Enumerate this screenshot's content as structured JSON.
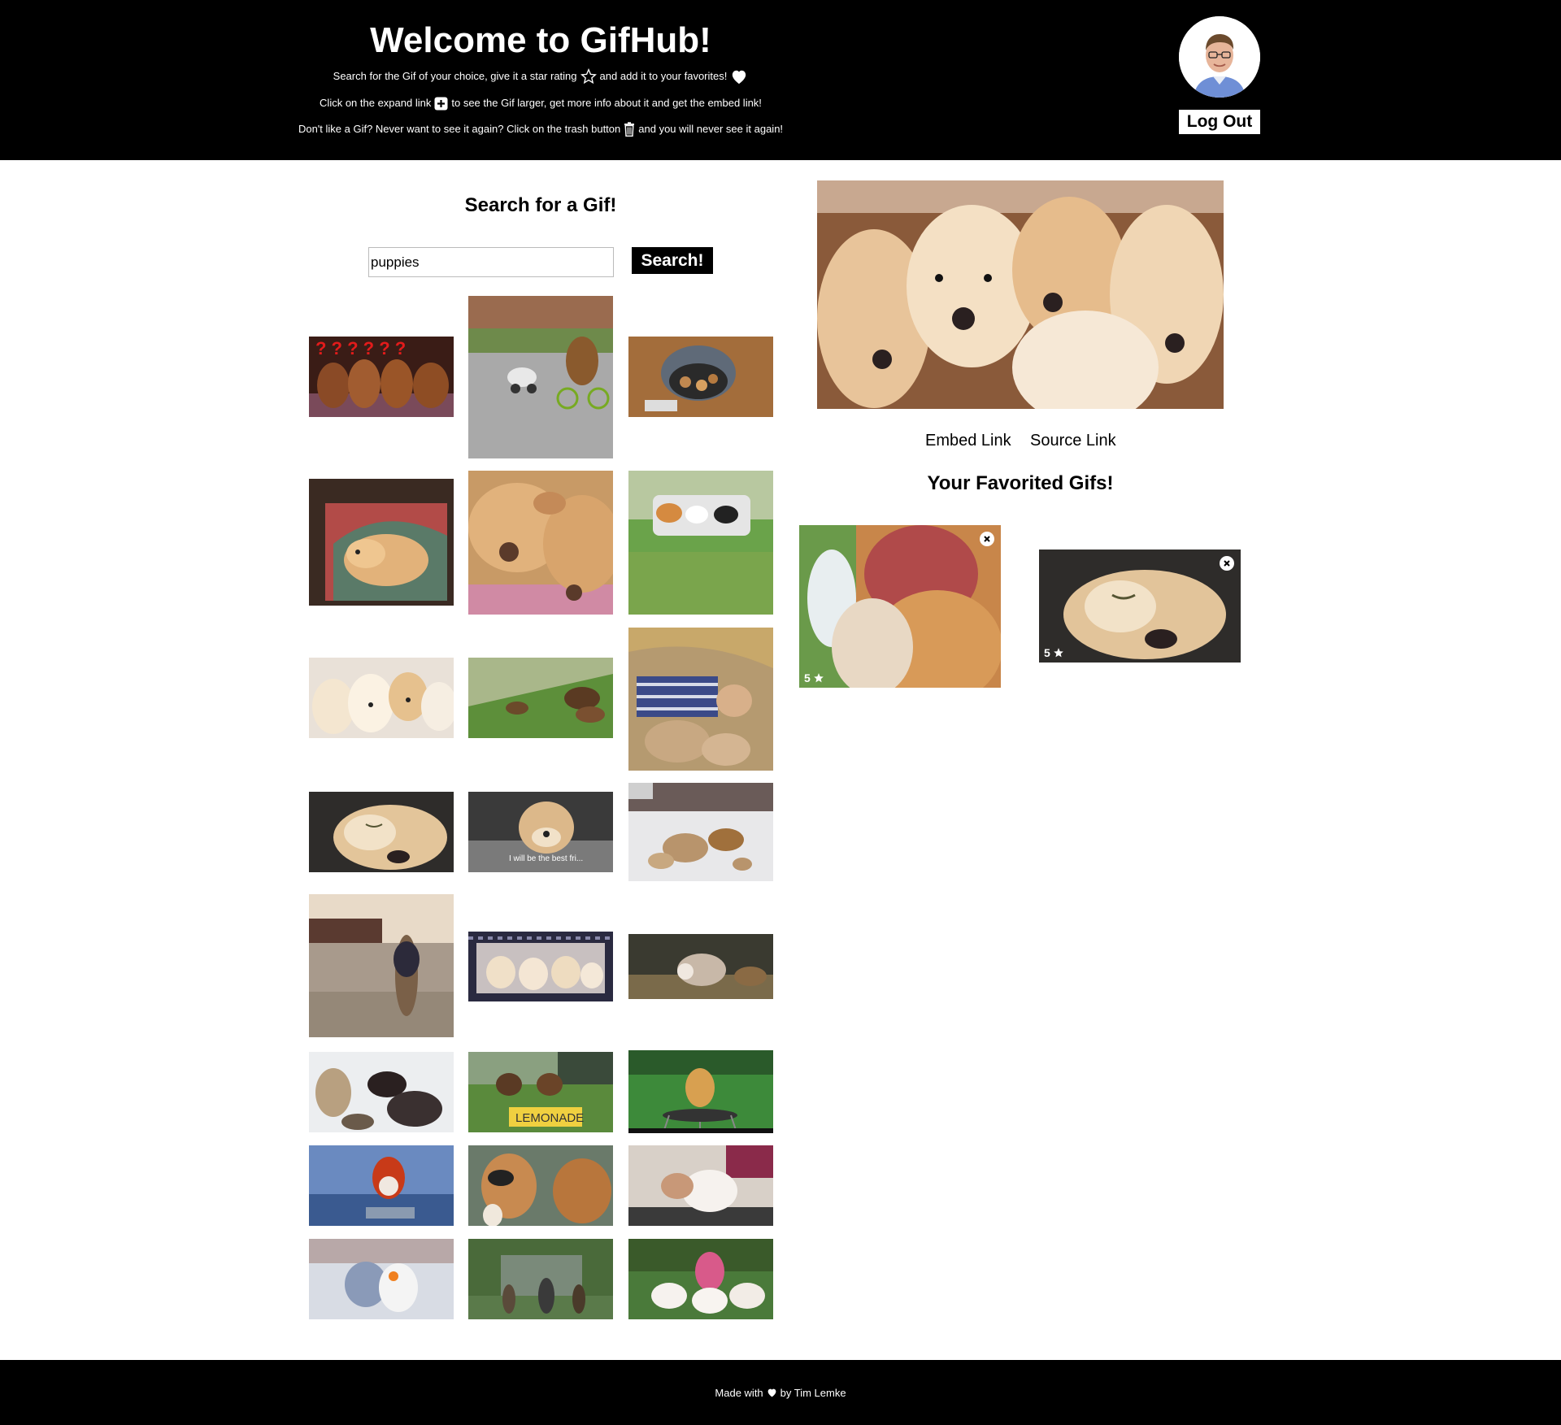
{
  "header": {
    "title": "Welcome to GifHub!",
    "line1_a": "Search for the Gif of your choice, give it a star rating",
    "line1_b": "and add it to your favorites!",
    "line2_a": "Click on the expand link",
    "line2_b": "to see the Gif larger, get more info about it and get the embed link!",
    "line3_a": "Don't like a Gif? Never want to see it again? Click on the trash button",
    "line3_b": "and you will never see it again!",
    "logout_label": "Log Out",
    "icons": [
      "star-outline-icon",
      "heart-icon",
      "plus-box-icon",
      "trash-icon"
    ]
  },
  "search": {
    "title": "Search for a Gif!",
    "query": "puppies",
    "button_label": "Search!"
  },
  "results_count": 24,
  "selected": {
    "embed_label": "Embed Link",
    "source_label": "Source Link"
  },
  "favorites": {
    "title": "Your Favorited Gifs!",
    "items": [
      {
        "rating": "5"
      },
      {
        "rating": "5"
      }
    ]
  },
  "footer": {
    "made_with": "Made with",
    "by": "by Tim Lemke"
  },
  "colors": {
    "header_bg": "#000000",
    "footer_bg": "#000000",
    "page_bg": "#ffffff"
  }
}
